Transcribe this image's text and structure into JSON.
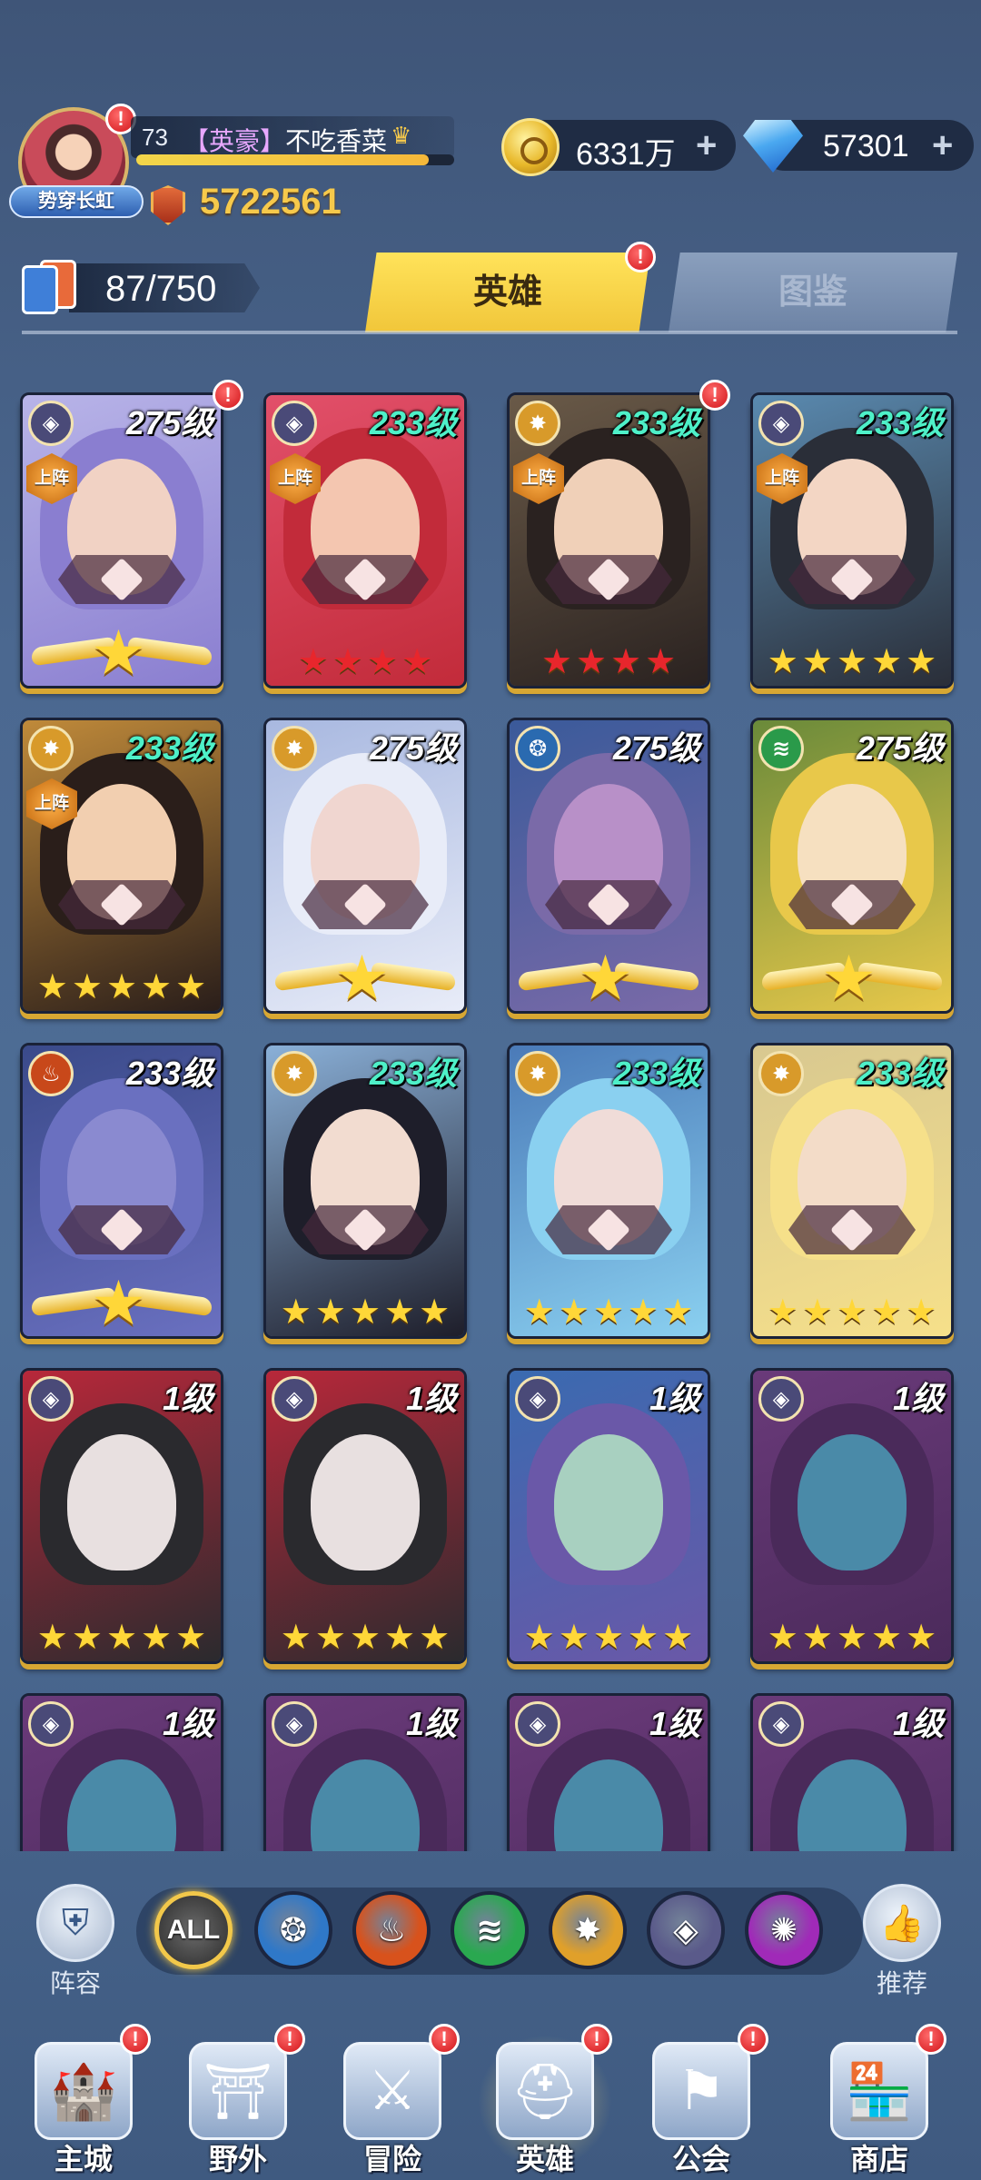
{
  "player": {
    "avatar_banner": "势穿长虹",
    "level": "73",
    "title_tag": "【英豪】",
    "name": "不吃香菜",
    "xp_progress": 0.92,
    "power": "5722561"
  },
  "resources": {
    "gold": "6331万",
    "diamonds": "57301"
  },
  "hero_count": "87/750",
  "tabs": [
    "英雄",
    "图鉴"
  ],
  "active_tab": "英雄",
  "deploy_label": "上阵",
  "heroes": [
    {
      "level": "275级",
      "level_color": "white",
      "faction": "void",
      "deployed": true,
      "stars": "wing",
      "alert": true,
      "palette": [
        "#b8b4e8",
        "#8a7ed0",
        "#f1d2c4"
      ]
    },
    {
      "level": "233级",
      "level_color": "green",
      "faction": "void",
      "deployed": true,
      "stars": "4red",
      "alert": false,
      "palette": [
        "#e2506a",
        "#c22b3a",
        "#f4c6b0"
      ]
    },
    {
      "level": "233级",
      "level_color": "green",
      "faction": "light",
      "deployed": true,
      "stars": "4red",
      "alert": true,
      "palette": [
        "#6a5a48",
        "#2a2220",
        "#f0d0b8"
      ]
    },
    {
      "level": "233级",
      "level_color": "green",
      "faction": "void",
      "deployed": true,
      "stars": "5gold",
      "alert": false,
      "palette": [
        "#5a8ab0",
        "#2a2e38",
        "#f3d6c4"
      ]
    },
    {
      "level": "233级",
      "level_color": "green",
      "faction": "light",
      "deployed": true,
      "stars": "5gold",
      "alert": false,
      "palette": [
        "#c08a3a",
        "#2a1e1a",
        "#f2cfb0"
      ]
    },
    {
      "level": "275级",
      "level_color": "white",
      "faction": "light",
      "deployed": false,
      "stars": "wing",
      "alert": false,
      "palette": [
        "#a8b8e0",
        "#e8ecf8",
        "#f0d6d0"
      ]
    },
    {
      "level": "275级",
      "level_color": "white",
      "faction": "water",
      "deployed": false,
      "stars": "wing",
      "alert": false,
      "palette": [
        "#3a5a9a",
        "#7a6aa8",
        "#b890c8"
      ]
    },
    {
      "level": "275级",
      "level_color": "white",
      "faction": "nature",
      "deployed": false,
      "stars": "wing",
      "alert": false,
      "palette": [
        "#6a8a3a",
        "#e8c84a",
        "#f6e0c0"
      ]
    },
    {
      "level": "233级",
      "level_color": "white",
      "faction": "fire",
      "deployed": false,
      "stars": "wing",
      "alert": false,
      "palette": [
        "#3a4a8a",
        "#6a70c0",
        "#8a8ad0"
      ]
    },
    {
      "level": "233级",
      "level_color": "green",
      "faction": "light",
      "deployed": false,
      "stars": "5gold",
      "alert": false,
      "palette": [
        "#8ab0d8",
        "#1e1e2a",
        "#f2dcd0"
      ]
    },
    {
      "level": "233级",
      "level_color": "green",
      "faction": "light",
      "deployed": false,
      "stars": "5gold",
      "alert": false,
      "palette": [
        "#4a7ab8",
        "#8ad0f0",
        "#f0dcd8"
      ]
    },
    {
      "level": "233级",
      "level_color": "green",
      "faction": "light",
      "deployed": false,
      "stars": "5gold",
      "alert": false,
      "palette": [
        "#d8c890",
        "#f6e08a",
        "#f3dcc8"
      ]
    },
    {
      "level": "1级",
      "level_color": "white",
      "faction": "void",
      "deployed": false,
      "stars": "5gold",
      "alert": false,
      "palette": [
        "#b8283a",
        "#2a2a2e",
        "#e8e0e0"
      ]
    },
    {
      "level": "1级",
      "level_color": "white",
      "faction": "void",
      "deployed": false,
      "stars": "5gold",
      "alert": false,
      "palette": [
        "#b8283a",
        "#2a2a2e",
        "#e8e0e0"
      ]
    },
    {
      "level": "1级",
      "level_color": "white",
      "faction": "void",
      "deployed": false,
      "stars": "5gold",
      "alert": false,
      "palette": [
        "#3a6ab0",
        "#6a58a8",
        "#a8d0c0"
      ]
    },
    {
      "level": "1级",
      "level_color": "white",
      "faction": "void",
      "deployed": false,
      "stars": "5gold",
      "alert": false,
      "palette": [
        "#6a3a7a",
        "#4a2a5a",
        "#4a8aa8"
      ]
    },
    {
      "level": "1级",
      "level_color": "white",
      "faction": "void",
      "deployed": false,
      "stars": "none",
      "alert": false,
      "palette": [
        "#6a3a7a",
        "#4a2a5a",
        "#4a8aa8"
      ]
    },
    {
      "level": "1级",
      "level_color": "white",
      "faction": "void",
      "deployed": false,
      "stars": "none",
      "alert": false,
      "palette": [
        "#6a3a7a",
        "#4a2a5a",
        "#4a8aa8"
      ]
    },
    {
      "level": "1级",
      "level_color": "white",
      "faction": "void",
      "deployed": false,
      "stars": "none",
      "alert": false,
      "palette": [
        "#6a3a7a",
        "#4a2a5a",
        "#4a8aa8"
      ]
    },
    {
      "level": "1级",
      "level_color": "white",
      "faction": "void",
      "deployed": false,
      "stars": "none",
      "alert": false,
      "palette": [
        "#6a3a7a",
        "#4a2a5a",
        "#4a8aa8"
      ]
    }
  ],
  "faction_colors": {
    "void": "#4a4a78",
    "light": "#d89a2a",
    "water": "#2a6ab0",
    "nature": "#2a9a4a",
    "fire": "#c8481a"
  },
  "filters": {
    "left_label": "阵容",
    "right_label": "推荐",
    "all_label": "ALL",
    "factions": [
      {
        "name": "water",
        "color": "#2f78c8"
      },
      {
        "name": "fire",
        "color": "#d8521c"
      },
      {
        "name": "nature",
        "color": "#2aa850"
      },
      {
        "name": "light",
        "color": "#e0a02a"
      },
      {
        "name": "void",
        "color": "#5a5a8a"
      },
      {
        "name": "arcane",
        "color": "#a02ab8"
      }
    ]
  },
  "bottom_nav": [
    {
      "label": "主城",
      "icon": "castle-icon",
      "alert": true,
      "active": false
    },
    {
      "label": "野外",
      "icon": "wilds-gate-icon",
      "alert": true,
      "active": false
    },
    {
      "label": "冒险",
      "icon": "adventure-arch-icon",
      "alert": true,
      "active": false
    },
    {
      "label": "英雄",
      "icon": "hero-helmet-icon",
      "alert": true,
      "active": true
    },
    {
      "label": "公会",
      "icon": "guild-banner-icon",
      "alert": true,
      "active": false
    },
    {
      "label": "商店",
      "icon": "shop-stall-icon",
      "alert": true,
      "active": false
    }
  ]
}
